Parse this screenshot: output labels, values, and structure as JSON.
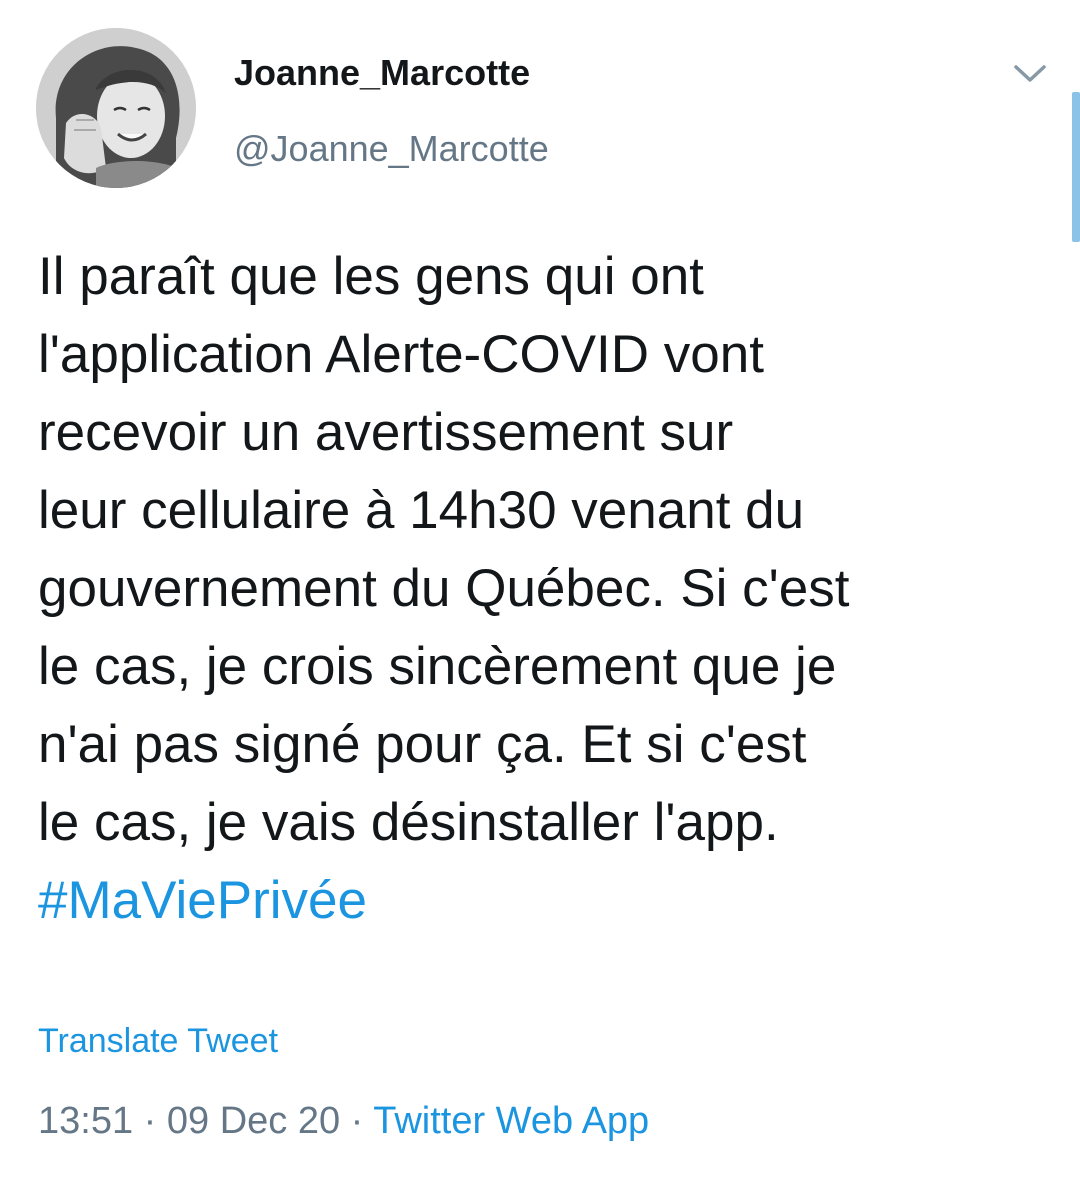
{
  "user": {
    "display_name": "Joanne_Marcotte",
    "handle": "@Joanne_Marcotte",
    "avatar_icon": "profile-photo"
  },
  "header": {
    "menu_icon": "chevron-down-icon"
  },
  "tweet": {
    "lines": [
      "Il paraît que les gens qui ont",
      "l'application Alerte-COVID vont",
      "recevoir un avertissement sur",
      "leur cellulaire à 14h30 venant du",
      "gouvernement du Québec. Si c'est",
      "le cas, je crois sincèrement que je",
      "n'ai pas signé pour ça. Et si c'est",
      "le cas, je vais désinstaller l'app."
    ],
    "hashtag": "#MaViePrivée"
  },
  "translate_label": "Translate Tweet",
  "meta": {
    "time": "13:51",
    "separator": " · ",
    "date": "09 Dec 20",
    "source": "Twitter Web App"
  },
  "colors": {
    "link": "#1b95e0",
    "muted": "#657786",
    "text": "#14171a"
  }
}
